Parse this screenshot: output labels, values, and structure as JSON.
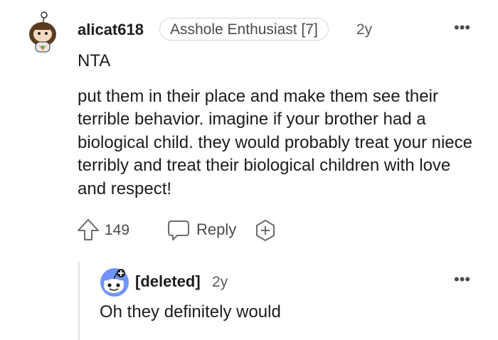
{
  "comment": {
    "author": "alicat618",
    "flair": "Asshole Enthusiast [7]",
    "age": "2y",
    "more": "•••",
    "verdict": "NTA",
    "body": "put them in their place and make them see their terrible behavior. imagine if your brother had a biological child. they would probably treat your niece terribly and treat their biological children with love and respect!",
    "score": "149",
    "reply_label": "Reply"
  },
  "reply": {
    "author": "[deleted]",
    "age": "2y",
    "more": "•••",
    "body": "Oh they definitely would"
  },
  "colors": {
    "text": "#1c1c1c",
    "meta": "#5a5a5a",
    "border": "#d6d6d6",
    "snoo_blue": "#7193ff"
  },
  "icons": [
    "snoo-avatar-icon",
    "more-options-icon",
    "upvote-arrow-icon",
    "reply-bubble-icon",
    "award-plus-icon",
    "deleted-snoo-avatar-icon"
  ]
}
